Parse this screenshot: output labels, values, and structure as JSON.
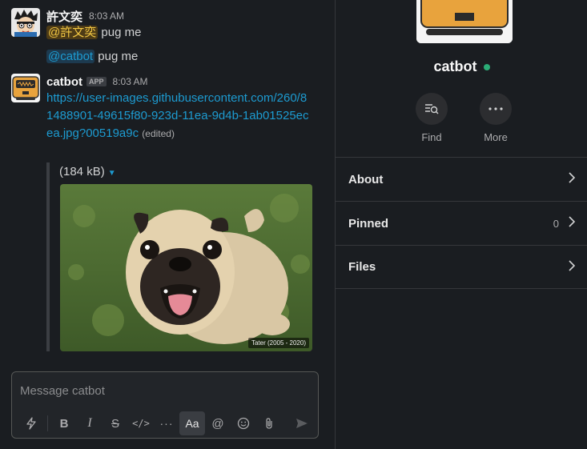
{
  "messages": [
    {
      "author": "許文奕",
      "time": "8:03 AM",
      "mention": "@許文奕",
      "text": "pug me"
    },
    {
      "mention": "@catbot",
      "text": "pug me"
    },
    {
      "author": "catbot",
      "badge": "APP",
      "time": "8:03 AM",
      "link": "https://user-images.githubusercontent.com/260/81488901-49615f80-923d-11ea-9d4b-1ab01525ecea.jpg?00519a9c",
      "edited": "(edited)",
      "attachment": {
        "size": "(184 kB)",
        "caption": "Tater (2005 - 2020)"
      }
    }
  ],
  "composer": {
    "placeholder": "Message catbot"
  },
  "details": {
    "name": "catbot",
    "actions": [
      {
        "label": "Find",
        "icon": "find-icon"
      },
      {
        "label": "More",
        "icon": "more-icon"
      }
    ],
    "sections": [
      {
        "label": "About",
        "count": ""
      },
      {
        "label": "Pinned",
        "count": "0"
      },
      {
        "label": "Files",
        "count": ""
      }
    ]
  },
  "colors": {
    "background": "#1a1d21",
    "link": "#1d9bd1",
    "mention_self_bg": "#4d3b16",
    "mention_self_fg": "#f2c744",
    "online": "#2bac76"
  }
}
